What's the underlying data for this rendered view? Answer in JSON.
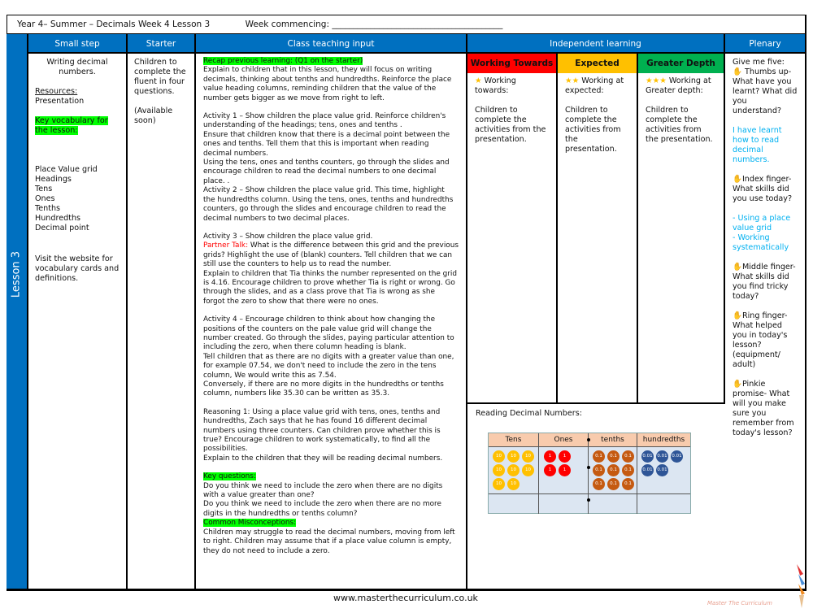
{
  "header": {
    "title": "Year 4– Summer – Decimals Week 4 Lesson 3",
    "week_commencing": "Week commencing: ________________________________________"
  },
  "columns": {
    "lesson": "Lesson 3",
    "small_step": "Small step",
    "starter": "Starter",
    "class_teaching": "Class teaching input",
    "independent": "Independent learning",
    "plenary": "Plenary"
  },
  "small_step": {
    "title": "Writing decimal numbers.",
    "resources_label": "Resources:",
    "resources": "Presentation",
    "vocab_label": "Key vocabulary for the lesson:",
    "vocab": [
      "Place Value grid",
      "Headings",
      "Tens",
      "Ones",
      "Tenths",
      "Hundredths",
      "Decimal point"
    ],
    "visit": "Visit the website for vocabulary cards and definitions."
  },
  "starter": {
    "text": "Children to complete the fluent in four questions.",
    "availability": "(Available soon)"
  },
  "teaching": {
    "recap": "Recap previous learning: (Q1 on the starter)",
    "p1": "Explain to children that in this lesson, they will focus on writing decimals, thinking about tenths and hundredths. Reinforce the place value heading columns, reminding children that the value of the number gets bigger as we move from right to left.",
    "p2": "Activity 1 – Show children the place value grid. Reinforce children's understanding of the headings; tens, ones and tenths .",
    "p3": "Ensure that children know that there is a decimal point between the ones and tenths. Tell them that this is important when reading decimal numbers.",
    "p4": "Using the tens, ones and tenths counters, go through the slides and encourage children to read the decimal numbers to one decimal place. .",
    "p5": "Activity 2 – Show children the place value grid. This time, highlight the hundredths column. Using the tens, ones, tenths and hundredths counters, go through the slides and encourage children to read the decimal numbers to two decimal places.",
    "p6": "Activity 3 – Show children the place value grid.",
    "partner_label": "Partner Talk:",
    "p7": " What is the difference between this grid and the previous grids? Highlight the use of (blank) counters. Tell children that we can still use the counters to help us to read the number.",
    "p8": "Explain to children that Tia thinks the number represented on the grid is 4.16. Encourage children to prove whether Tia is right or wrong. Go through the slides, and as a class prove that Tia is wrong as she forgot the zero to show that there were no ones.",
    "p9": "Activity 4 – Encourage children to think about how changing the positions of the counters on the pale value grid will change the number created. Go through the slides, paying particular attention to including the zero, when there column heading is blank.",
    "p10": "Tell children that as there are no digits with a greater value than one, for example 07.54, we don't need to include the zero in the tens column, We would write this as 7.54.",
    "p11": "Conversely, if there are no more digits in the hundredths or tenths column, numbers like 35.30 can be written as 35.3.",
    "p12": "Reasoning 1: Using a place value grid with tens, ones, tenths and hundredths, Zach says that he has found 16 different decimal numbers using three counters. Can children prove whether this is true? Encourage children to work systematically, to find all the possibilities.",
    "p13": "Explain to the children that they will be reading decimal numbers.",
    "kq_label": "Key questions:",
    "kq1": "Do you think we need to include the zero when there are no digits with a value greater than one?",
    "kq2": "Do you think we need to include the zero when there are no more digits in the hundredths or tenths column?",
    "cm_label": "Common Misconceptions:",
    "cm": "Children may struggle to read the decimal numbers, moving from left to right. Children may assume that if a place value column is empty, they do not need to include a zero."
  },
  "independent": {
    "levels": [
      {
        "label": "Working Towards",
        "color": "#ff0000",
        "stars": "★",
        "heading": "Working towards:",
        "body": "Children to complete the activities from the presentation."
      },
      {
        "label": "Expected",
        "color": "#ffc000",
        "stars": "★★",
        "heading": "Working at expected:",
        "body": "Children to complete the activities from the presentation."
      },
      {
        "label": "Greater Depth",
        "color": "#00b050",
        "stars": "★★★",
        "heading": "Working at Greater depth:",
        "body": "Children to complete the activities from the presentation."
      }
    ],
    "picture_caption": "Reading Decimal Numbers:",
    "grid_headers": [
      "Tens",
      "Ones",
      "tenths",
      "hundredths"
    ],
    "counters": {
      "tens": 8,
      "ones": 4,
      "tenths": 9,
      "hundredths": 5
    },
    "counter_labels": {
      "tens": "10",
      "ones": "1",
      "tenths": "0.1",
      "hundredths": "0.01"
    }
  },
  "plenary": {
    "intro": "Give me five:",
    "thumb": "Thumbs up- What have you learnt? What did you understand?",
    "thumb_answer": "I have learnt how to read decimal numbers.",
    "index": "Index finger- What skills did you use today?",
    "index_answer": "- Using a place value grid\n- Working systematically",
    "middle": "Middle finger- What skills did you find tricky today?",
    "ring": "Ring finger- What helped you in today's lesson? (equipment/ adult)",
    "pinkie": "Pinkie promise- What will you make sure you remember from today's lesson?"
  },
  "footer": {
    "url": "www.masterthecurriculum.co.uk",
    "logo_text": "Master The Curriculum"
  }
}
